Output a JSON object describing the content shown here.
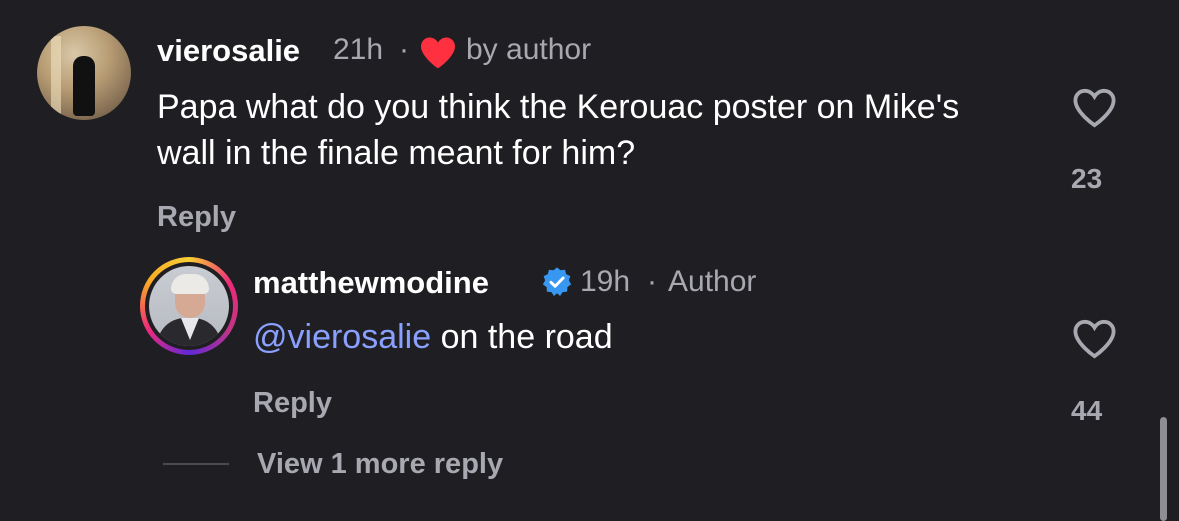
{
  "comment": {
    "username": "vierosalie",
    "time": "21h",
    "separator": "·",
    "liked_by_author": "by author",
    "text": "Papa what do you think the Kerouac poster on Mike's wall in the finale meant for him?",
    "reply_label": "Reply",
    "like_count": "23"
  },
  "reply_comment": {
    "username": "matthewmodine",
    "time": "19h",
    "separator": "·",
    "badge": "Author",
    "mention": "@vierosalie",
    "text": " on the road",
    "reply_label": "Reply",
    "like_count": "44"
  },
  "view_more": "View 1 more reply",
  "colors": {
    "background": "#1f1f23",
    "secondary_text": "#a8a8b0",
    "mention": "#8aa0ff",
    "heart_red": "#ff3040",
    "verified_blue": "#3897f0"
  },
  "icons": {
    "author_like": "heart-filled-icon",
    "like": "heart-outline-icon",
    "verified": "verified-badge-icon"
  }
}
